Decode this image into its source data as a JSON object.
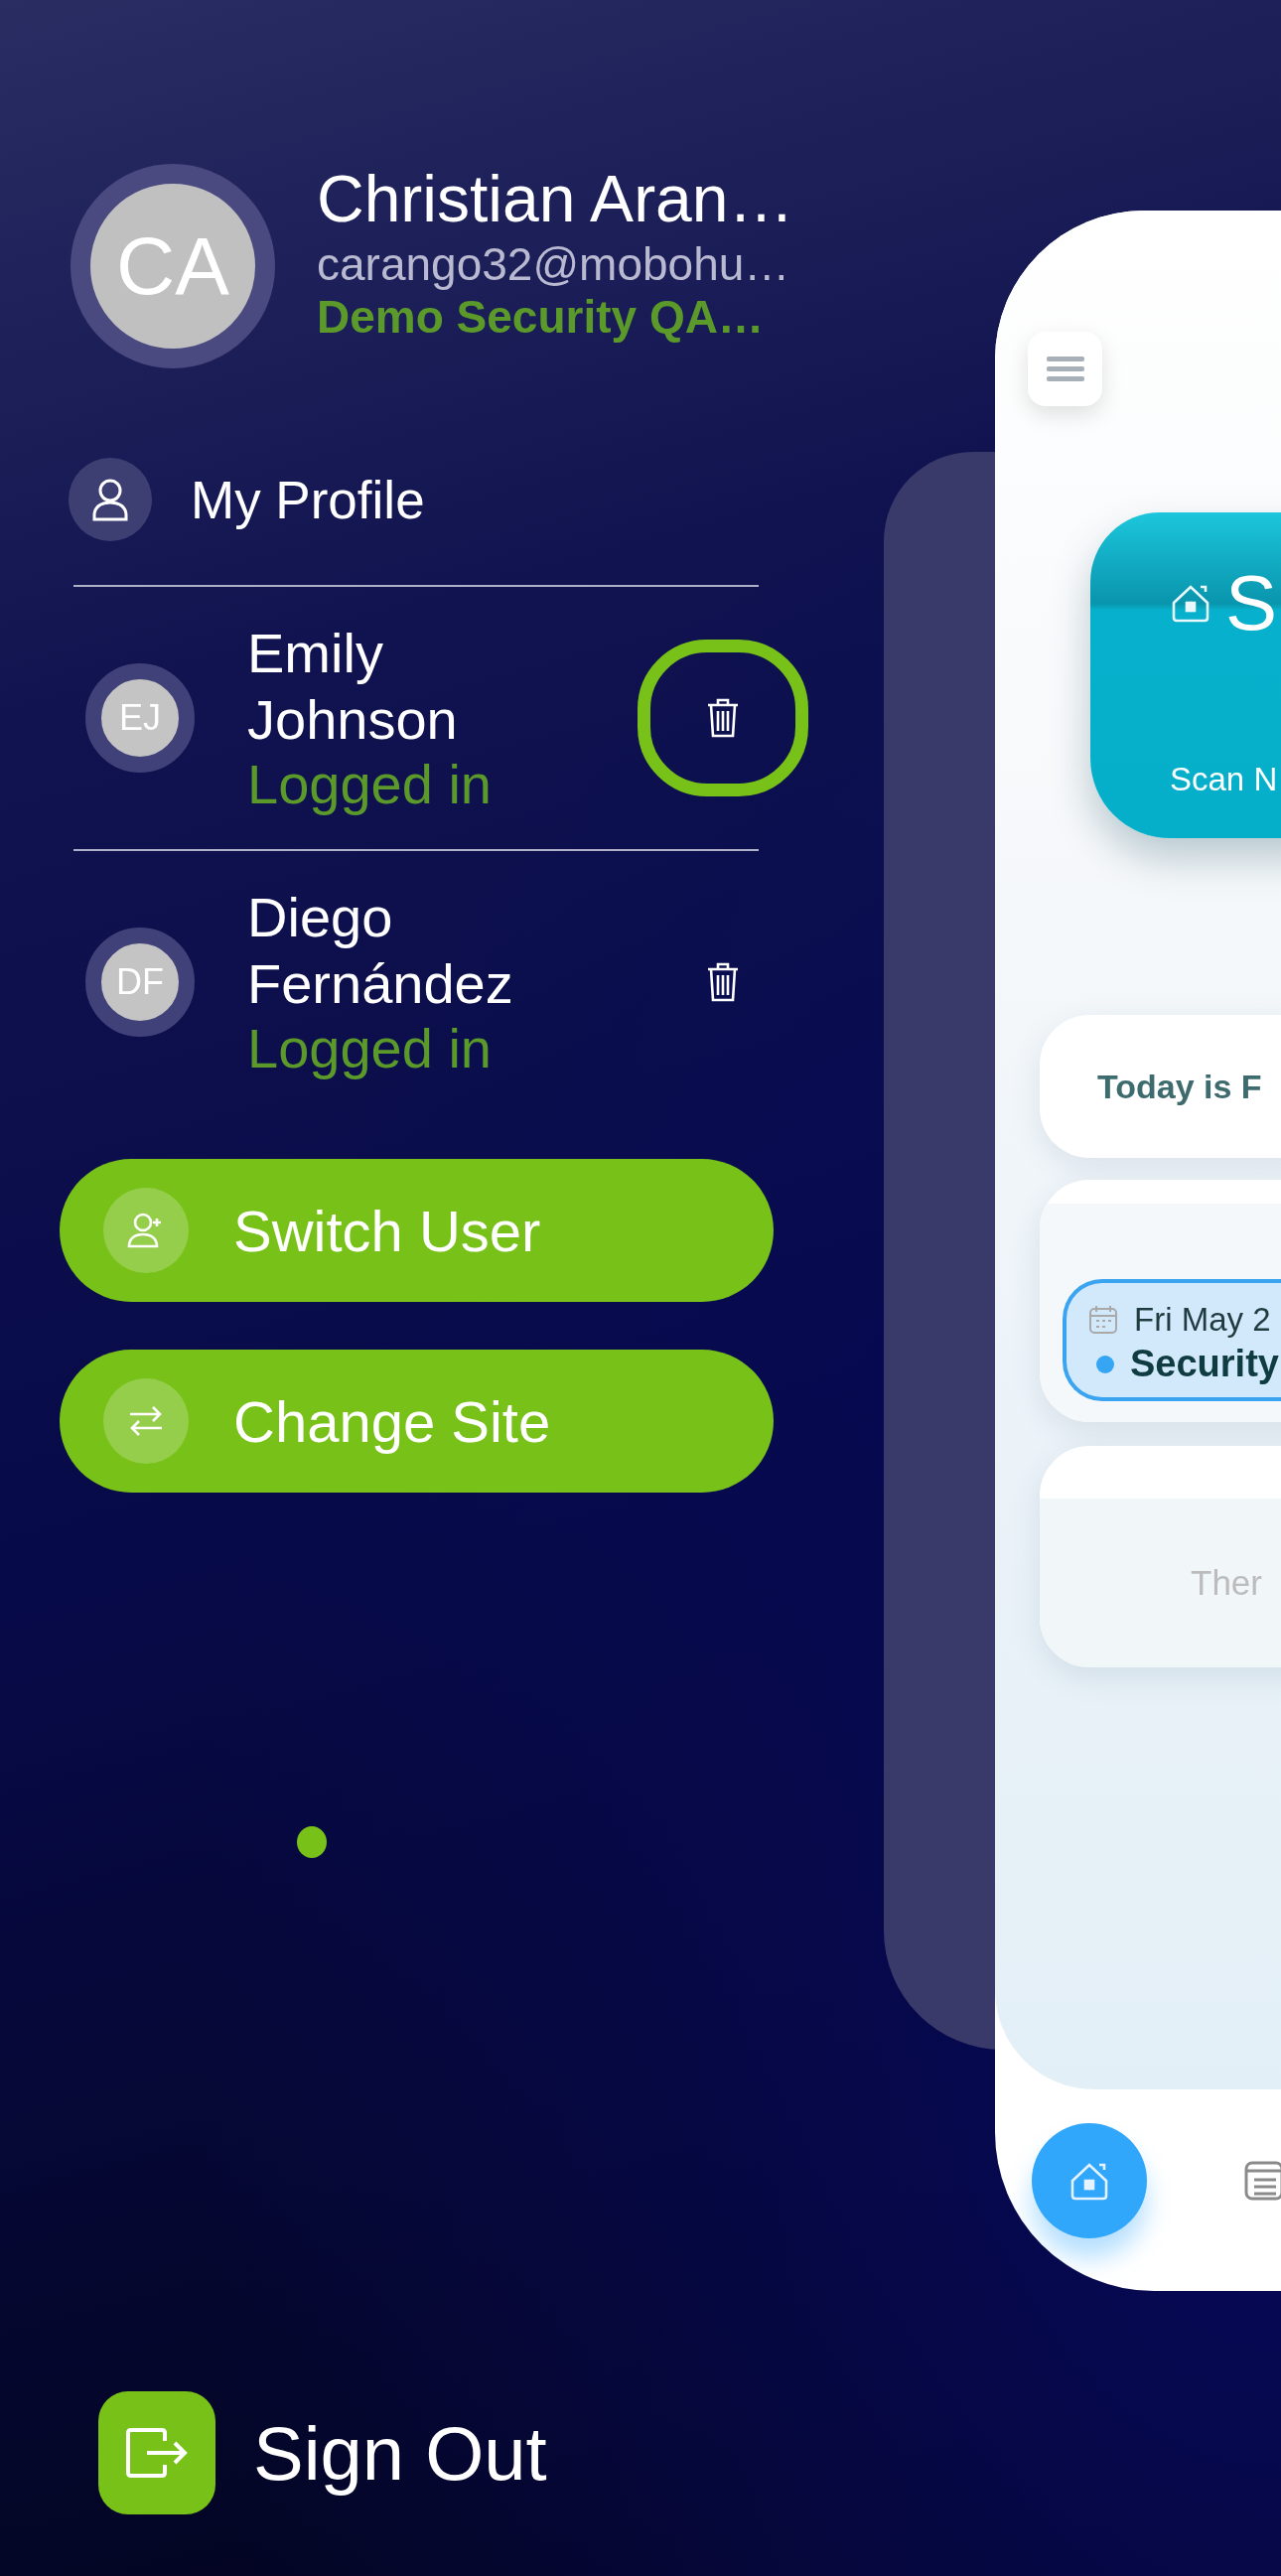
{
  "current_user": {
    "initials": "CA",
    "name": "Christian Aran…",
    "email": "carango32@mobohu…",
    "site": "Demo Security QA…"
  },
  "profile_link": {
    "label": "My Profile"
  },
  "accounts": [
    {
      "initials": "EJ",
      "name": "Emily Johnson",
      "status": "Logged in",
      "highlighted": true
    },
    {
      "initials": "DF",
      "name": "Diego Fernández",
      "status": "Logged in",
      "highlighted": false
    }
  ],
  "actions": [
    {
      "kind": "switch_user",
      "label": "Switch User"
    },
    {
      "kind": "change_site",
      "label": "Change Site"
    }
  ],
  "sign_out": {
    "label": "Sign Out"
  },
  "preview": {
    "banner": {
      "title": "S",
      "subtitle": "Scan N"
    },
    "date_card": {
      "text": "Today is F"
    },
    "event": {
      "date": "Fri May 2",
      "title": "Security"
    },
    "empty_card": {
      "text": "Ther"
    },
    "tabs": [
      {
        "kind": "home",
        "selected": true
      },
      {
        "kind": "list",
        "selected": false
      }
    ]
  }
}
